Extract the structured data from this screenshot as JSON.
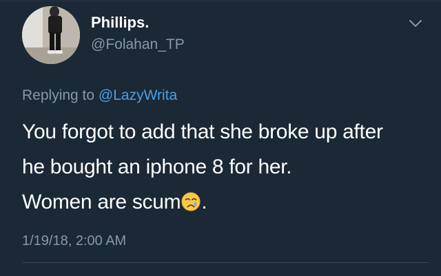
{
  "tweet": {
    "author": {
      "display_name": "Phillips.",
      "handle": "@Folahan_TP"
    },
    "reply_prefix": "Replying to ",
    "reply_mention": "@LazyWrita",
    "text_lines": [
      "You forgot to add that she broke up after",
      "he bought an iphone 8 for her.",
      "Women are scum"
    ],
    "text_suffix": ".",
    "emoji": "crying-face-icon",
    "timestamp": "1/19/18, 2:00 AM"
  },
  "colors": {
    "background": "#1b2836",
    "primary_text": "#ffffff",
    "secondary_text": "#8899a6",
    "link": "#4a9fe8"
  },
  "icons": {
    "menu": "chevron-down-icon"
  }
}
